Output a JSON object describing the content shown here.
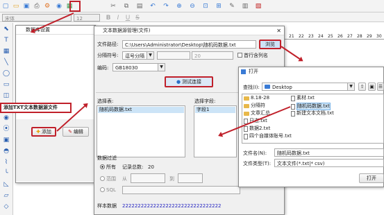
{
  "toolbar": {
    "font_name": "宋体",
    "font_size": "12",
    "style_buttons": [
      "B",
      "I",
      "U",
      "S"
    ],
    "icons": [
      "new-icon",
      "open-icon",
      "save-icon",
      "print-icon",
      "settings-icon",
      "database-icon",
      "grid-icon",
      "cut-icon",
      "copy-icon",
      "paste-icon",
      "undo-icon",
      "redo-icon",
      "zoom-in-icon",
      "zoom-out-icon",
      "zoom-fit-icon",
      "zoom-actual-icon",
      "tools-icon",
      "lock-icon",
      "print-preview-icon"
    ]
  },
  "ruler": {
    "ticks": [
      "21",
      "22",
      "23",
      "24",
      "25",
      "26",
      "27",
      "28",
      "29",
      "30"
    ]
  },
  "db_settings": {
    "title": "数据库设置",
    "callout": "添加TXT文本数据源文件",
    "add_label": "添加",
    "edit_label": "编辑"
  },
  "txt_manager": {
    "title": "文本数据源管理(文件)",
    "path_label": "文件路径:",
    "path_value": "C:\\Users\\Administrator\\Desktop\\随机码数据.txt",
    "browse": "浏览",
    "separator_label": "分隔符号:",
    "separator_value": "逗号分隔",
    "separator_extra": "20",
    "first_row_label": "首行含列名",
    "encoding_label": "编码:",
    "encoding_value": "GB18030",
    "test_button": "测试连接",
    "select_table_label": "选择表:",
    "table_item": "随机码数据.txt",
    "select_field_label": "选择字段:",
    "field_item": "字段1",
    "filter_label": "数据过滤",
    "all_label": "所有",
    "record_count_label": "记录总数:",
    "record_count": "20",
    "range_label": "范围",
    "from_label": "从",
    "to_label": "到",
    "sql_label": "SQL",
    "sample_label": "样本数据",
    "sample_value": "22222222222222222222222222222222"
  },
  "open_dialog": {
    "title": "打开",
    "lookin_label": "查找(I):",
    "lookin_value": "Desktop",
    "files_col1": [
      "8.18-28",
      "分隔符",
      "文章汇总",
      "日志.txt",
      "数据2.txt",
      "四个自媒体账号.txt"
    ],
    "files_col2": [
      "素材.txt",
      "随机码数据.txt",
      "新建文本文档.txt"
    ],
    "selected_file": "随机码数据.txt",
    "filename_label": "文件名(N):",
    "filename_value": "随机码数据.txt",
    "filetype_label": "文件类型(T):",
    "filetype_value": "文本文件(*.txt|* csv)",
    "open_button": "打开"
  },
  "colors": {
    "accent": "#c0202a",
    "highlight": "#3399ff",
    "sample_text": "#2020c0"
  }
}
